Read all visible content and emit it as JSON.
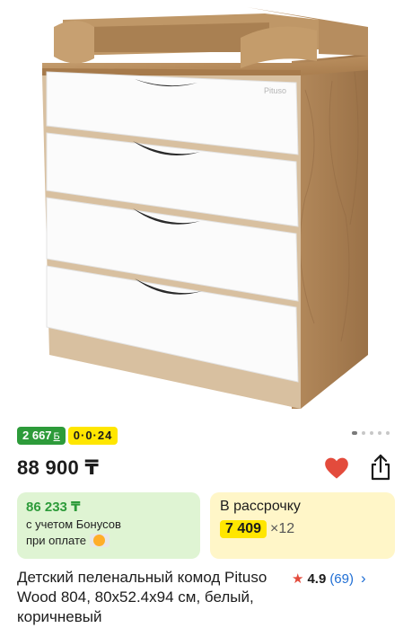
{
  "product": {
    "brand_mark": "Pituso",
    "image_dots": 5,
    "active_dot": 0
  },
  "badges": {
    "bonus": "2 667",
    "bonus_currency": "Б",
    "installment": "0·0·24"
  },
  "price": "88 900 ₸",
  "bonus_card": {
    "price": "86 233 ₸",
    "line1": "с учетом Бонусов",
    "line2": "при оплате"
  },
  "installment_card": {
    "title": "В рассрочку",
    "amount": "7 409",
    "multiplier": "×12"
  },
  "title": "Детский пеленальный комод Pituso Wood 804, 80x52.4x94 см, белый, коричневый",
  "rating": {
    "value": "4.9",
    "count": "(69)"
  },
  "colors": {
    "accent_green": "#2d9b3a",
    "accent_yellow": "#ffe600",
    "heart_red": "#e34b3c",
    "link_blue": "#1f6ed4"
  },
  "icons": [
    "heart-icon",
    "share-icon",
    "star-icon",
    "chevron-right-icon"
  ]
}
